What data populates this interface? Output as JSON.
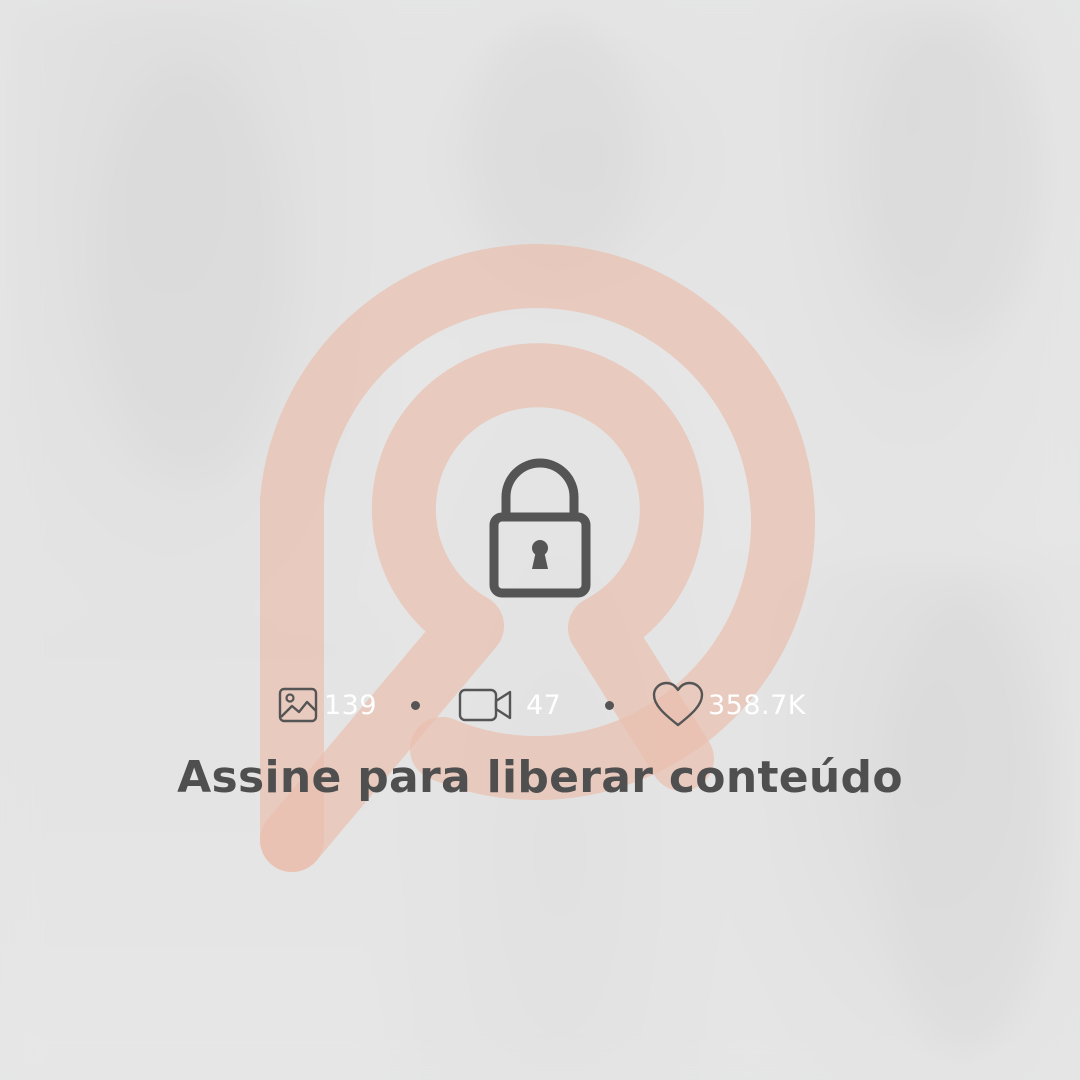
{
  "paywall": {
    "brand_logo": "privacy-keyhole-logo",
    "lock_icon": "lock-icon",
    "stats": {
      "photos": {
        "icon": "image-icon",
        "count": "139"
      },
      "videos": {
        "icon": "video-camera-icon",
        "count": "47"
      },
      "likes": {
        "icon": "heart-icon",
        "count": "358.7K"
      }
    },
    "cta_text": "Assine para liberar conteúdo"
  },
  "colors": {
    "background": "#e2e3e3",
    "logo": "#e9bfae",
    "icon": "#555555",
    "cta_text": "#4f4f4f",
    "stat_text": "#ffffff"
  }
}
